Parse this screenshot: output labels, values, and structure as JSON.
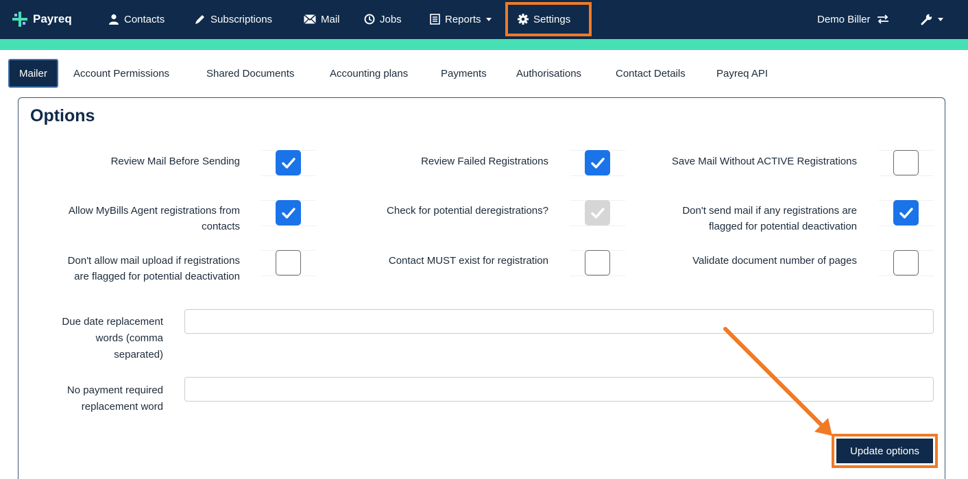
{
  "colors": {
    "navbar_bg": "#0f2a4a",
    "accent_bar": "#46e0b4",
    "highlight": "#f07a26",
    "checkbox_checked": "#1a73e8"
  },
  "navbar": {
    "brand": "Payreq",
    "items": [
      {
        "label": "Contacts",
        "icon": "user-icon"
      },
      {
        "label": "Subscriptions",
        "icon": "pencil-icon"
      },
      {
        "label": "Mail",
        "icon": "envelope-icon"
      },
      {
        "label": "Jobs",
        "icon": "clock-icon"
      },
      {
        "label": "Reports",
        "icon": "report-icon",
        "dropdown": true
      },
      {
        "label": "Settings",
        "icon": "gear-icon",
        "highlighted": true
      }
    ],
    "biller": "Demo Biller",
    "biller_icon": "swap-icon",
    "tools_icon": "wrench-icon"
  },
  "tabs": [
    {
      "label": "Mailer",
      "active": true
    },
    {
      "label": "Account Permissions"
    },
    {
      "label": "Shared Documents"
    },
    {
      "label": "Accounting plans"
    },
    {
      "label": "Payments"
    },
    {
      "label": "Authorisations"
    },
    {
      "label": "Contact Details"
    },
    {
      "label": "Payreq API"
    }
  ],
  "options": {
    "title": "Options",
    "checkboxes": [
      {
        "line1": "Review Mail Before Sending",
        "line2": "",
        "checked": true,
        "disabled": false
      },
      {
        "line1": "Review Failed Registrations",
        "line2": "",
        "checked": true,
        "disabled": false
      },
      {
        "line1": "Save Mail Without ACTIVE Registrations",
        "line2": "",
        "checked": false,
        "disabled": false
      },
      {
        "line1": "Allow MyBills Agent registrations from",
        "line2": "contacts",
        "checked": true,
        "disabled": false
      },
      {
        "line1": "Check for potential deregistrations?",
        "line2": "",
        "checked": true,
        "disabled": true
      },
      {
        "line1": "Don't send mail if any registrations are",
        "line2": "flagged for potential deactivation",
        "checked": true,
        "disabled": false
      },
      {
        "line1": "Don't allow mail upload if registrations",
        "line2": "are flagged for potential deactivation",
        "checked": false,
        "disabled": false
      },
      {
        "line1": "Contact MUST exist for registration",
        "line2": "",
        "checked": false,
        "disabled": false
      },
      {
        "line1": "Validate document number of pages",
        "line2": "",
        "checked": false,
        "disabled": false
      }
    ],
    "fields": {
      "due_date": {
        "line1": "Due date replacement",
        "line2": "words (comma",
        "line3": "separated)",
        "value": ""
      },
      "no_payment": {
        "line1": "No payment required",
        "line2": "replacement word",
        "value": ""
      }
    },
    "update_label": "Update options"
  }
}
